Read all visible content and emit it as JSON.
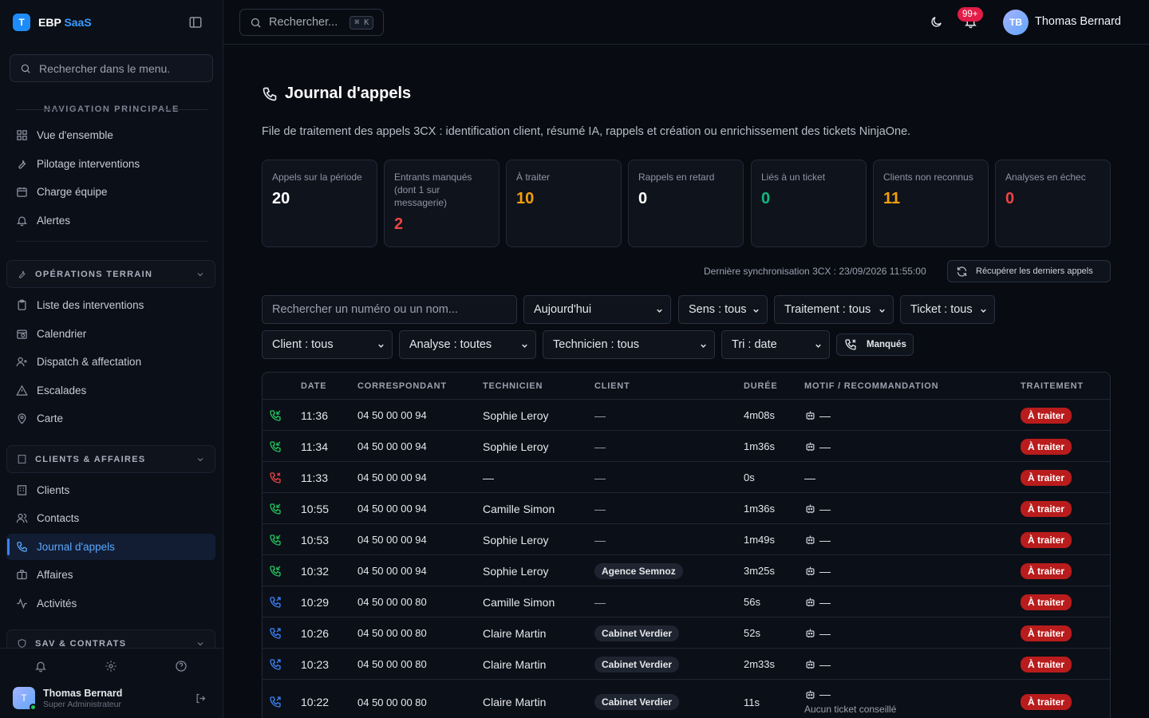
{
  "brand": {
    "logo": "T",
    "name": "EBP",
    "suffix": "SaaS"
  },
  "sidebar": {
    "search_placeholder": "Rechercher dans le menu.",
    "main_title": "NAVIGATION PRINCIPALE",
    "main_items": [
      "Vue d'ensemble",
      "Pilotage interventions",
      "Charge équipe",
      "Alertes"
    ],
    "group1": "OPÉRATIONS TERRAIN",
    "group1_items": [
      "Liste des interventions",
      "Calendrier",
      "Dispatch & affectation",
      "Escalades",
      "Carte"
    ],
    "group2": "CLIENTS & AFFAIRES",
    "group2_items": [
      "Clients",
      "Contacts",
      "Journal d'appels",
      "Affaires",
      "Activités"
    ],
    "group3": "SAV & CONTRATS",
    "user": {
      "initial": "T",
      "name": "Thomas Bernard",
      "role": "Super Administrateur"
    }
  },
  "topbar": {
    "search": "Rechercher...",
    "shortcut": "⌘ K",
    "notif_badge": "99+",
    "avatar": "TB",
    "user": "Thomas Bernard"
  },
  "page": {
    "title": "Journal d'appels",
    "description": "File de traitement des appels 3CX : identification client, résumé IA, rappels et création ou enrichissement des tickets NinjaOne."
  },
  "kpis": [
    {
      "label": "Appels sur la période",
      "value": "20",
      "color": "#ffffff"
    },
    {
      "label": "Entrants manqués (dont 1 sur messagerie)",
      "value": "2",
      "color": "#ef4444"
    },
    {
      "label": "À traiter",
      "value": "10",
      "color": "#f59e0b"
    },
    {
      "label": "Rappels en retard",
      "value": "0",
      "color": "#ffffff"
    },
    {
      "label": "Liés à un ticket",
      "value": "0",
      "color": "#10b981"
    },
    {
      "label": "Clients non reconnus",
      "value": "11",
      "color": "#f59e0b"
    },
    {
      "label": "Analyses en échec",
      "value": "0",
      "color": "#ef4444"
    }
  ],
  "sync": {
    "text": "Dernière synchronisation 3CX : 23/09/2026 11:55:00",
    "button": "Récupérer les derniers appels"
  },
  "filters": {
    "search_placeholder": "Rechercher un numéro ou un nom...",
    "period": "Aujourd'hui",
    "sens": "Sens : tous",
    "traitement": "Traitement : tous",
    "ticket": "Ticket : tous",
    "client": "Client : tous",
    "analyse": "Analyse : toutes",
    "technicien": "Technicien : tous",
    "tri": "Tri : date",
    "missed_button": "Manqués"
  },
  "table": {
    "headers": [
      "DATE",
      "CORRESPONDANT",
      "TECHNICIEN",
      "CLIENT",
      "DURÉE",
      "MOTIF / RECOMMANDATION",
      "TRAITEMENT"
    ],
    "rows": [
      {
        "dir": "in",
        "time": "11:36",
        "number": "04 50 00 00 94",
        "tech": "Sophie Leroy",
        "client": "—",
        "client_pill": false,
        "dur": "4m08s",
        "motif": "—",
        "motif_icon": true,
        "note": "",
        "status": "À traiter"
      },
      {
        "dir": "in",
        "time": "11:34",
        "number": "04 50 00 00 94",
        "tech": "Sophie Leroy",
        "client": "—",
        "client_pill": false,
        "dur": "1m36s",
        "motif": "—",
        "motif_icon": true,
        "note": "",
        "status": "À traiter"
      },
      {
        "dir": "missed",
        "time": "11:33",
        "number": "04 50 00 00 94",
        "tech": "—",
        "client": "—",
        "client_pill": false,
        "dur": "0s",
        "motif": "—",
        "motif_icon": false,
        "note": "",
        "status": "À traiter"
      },
      {
        "dir": "in",
        "time": "10:55",
        "number": "04 50 00 00 94",
        "tech": "Camille Simon",
        "client": "—",
        "client_pill": false,
        "dur": "1m36s",
        "motif": "—",
        "motif_icon": true,
        "note": "",
        "status": "À traiter"
      },
      {
        "dir": "in",
        "time": "10:53",
        "number": "04 50 00 00 94",
        "tech": "Sophie Leroy",
        "client": "—",
        "client_pill": false,
        "dur": "1m49s",
        "motif": "—",
        "motif_icon": true,
        "note": "",
        "status": "À traiter"
      },
      {
        "dir": "in",
        "time": "10:32",
        "number": "04 50 00 00 94",
        "tech": "Sophie Leroy",
        "client": "Agence Semnoz",
        "client_pill": true,
        "dur": "3m25s",
        "motif": "—",
        "motif_icon": true,
        "note": "",
        "status": "À traiter"
      },
      {
        "dir": "out",
        "time": "10:29",
        "number": "04 50 00 00 80",
        "tech": "Camille Simon",
        "client": "—",
        "client_pill": false,
        "dur": "56s",
        "motif": "—",
        "motif_icon": true,
        "note": "",
        "status": "À traiter"
      },
      {
        "dir": "out",
        "time": "10:26",
        "number": "04 50 00 00 80",
        "tech": "Claire Martin",
        "client": "Cabinet Verdier",
        "client_pill": true,
        "dur": "52s",
        "motif": "—",
        "motif_icon": true,
        "note": "",
        "status": "À traiter"
      },
      {
        "dir": "out",
        "time": "10:23",
        "number": "04 50 00 00 80",
        "tech": "Claire Martin",
        "client": "Cabinet Verdier",
        "client_pill": true,
        "dur": "2m33s",
        "motif": "—",
        "motif_icon": true,
        "note": "",
        "status": "À traiter"
      },
      {
        "dir": "out",
        "time": "10:22",
        "number": "04 50 00 00 80",
        "tech": "Claire Martin",
        "client": "Cabinet Verdier",
        "client_pill": true,
        "dur": "11s",
        "motif": "—",
        "motif_icon": true,
        "note": "Aucun ticket conseillé",
        "status": "À traiter"
      }
    ]
  },
  "colors": {
    "accent": "#3b82f6",
    "incoming": "#22c55e",
    "missed": "#ef4444",
    "outgoing": "#3b82f6",
    "status_bg": "#b91c1c"
  }
}
